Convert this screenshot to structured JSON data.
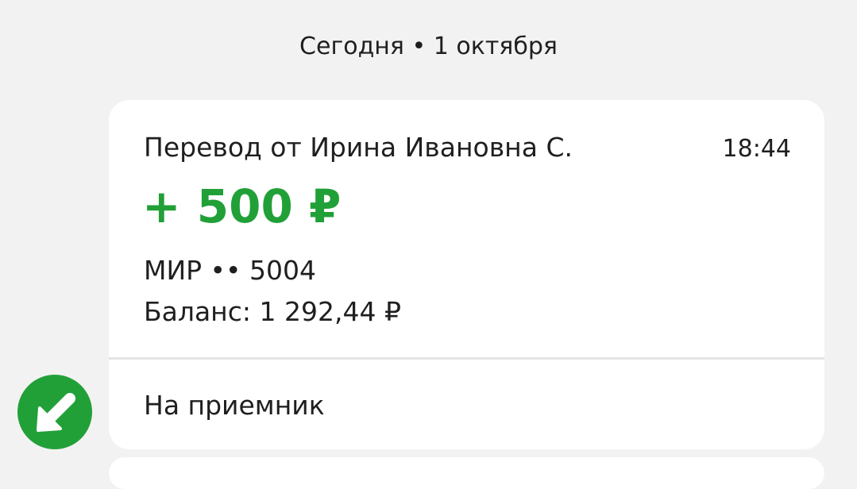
{
  "chat": {
    "date_label": "Сегодня • 1 октября"
  },
  "transaction": {
    "title": "Перевод от Ирина Ивановна С.",
    "time": "18:44",
    "amount": "+ 500 ₽",
    "card": "МИР •• 5004",
    "balance": "Баланс: 1 292,44 ₽",
    "note": "На приемник",
    "direction_icon": "incoming-arrow-icon"
  },
  "colors": {
    "background": "#f2f2f2",
    "bubble": "#ffffff",
    "accent_green": "#21a038",
    "divider": "#e4e4e4",
    "text": "#1f1f1f"
  }
}
